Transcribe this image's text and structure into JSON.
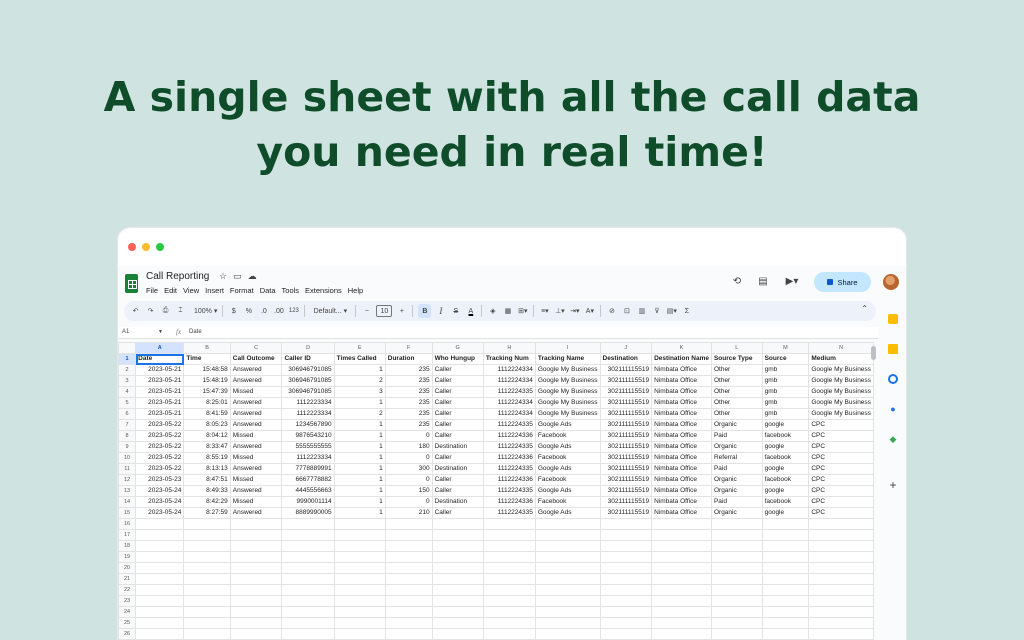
{
  "headline": {
    "line1": "A single sheet with all the call data",
    "line2": "you need in real time!"
  },
  "window": {
    "controls": [
      "close",
      "minimize",
      "maximize"
    ]
  },
  "app": {
    "title": "Call Reporting",
    "menu": [
      "File",
      "Edit",
      "View",
      "Insert",
      "Format",
      "Data",
      "Tools",
      "Extensions",
      "Help"
    ],
    "share_label": "Share",
    "toolbar": {
      "zoom": "100%",
      "currency": "$",
      "percent": "%",
      "dec_decrease": ".0",
      "dec_increase": ".00",
      "format_123": "123",
      "font": "Default...",
      "font_size": "10",
      "minus": "−",
      "plus": "+",
      "bold": "B",
      "italic": "I",
      "strike": "S",
      "text_color": "A",
      "sigma": "Σ"
    },
    "name_box": "A1",
    "formula_value": "Date"
  },
  "colors": {
    "headline": "#0f4d2a",
    "background": "#cfe3e0",
    "share_bg": "#c2e7ff",
    "selection": "#1a73e8"
  },
  "columns": [
    "A",
    "B",
    "C",
    "D",
    "E",
    "F",
    "G",
    "H",
    "I",
    "J",
    "K",
    "L",
    "M",
    "N"
  ],
  "rows": [
    [
      "Date",
      "Time",
      "Call Outcome",
      "Caller ID",
      "Times Called",
      "Duration",
      "Who Hungup",
      "Tracking Num",
      "Tracking Name",
      "Destination",
      "Destination Name",
      "Source Type",
      "Source",
      "Medium"
    ],
    [
      "2023-05-21",
      "15:48:58",
      "Answered",
      "306946791085",
      "1",
      "235",
      "Caller",
      "1112224334",
      "Google My Business",
      "302111115519",
      "Nimbata Office",
      "Other",
      "gmb",
      "Google My Business"
    ],
    [
      "2023-05-21",
      "15:48:19",
      "Answered",
      "306946791085",
      "2",
      "235",
      "Caller",
      "1112224334",
      "Google My Business",
      "302111115519",
      "Nimbata Office",
      "Other",
      "gmb",
      "Google My Business"
    ],
    [
      "2023-05-21",
      "15:47:39",
      "Missed",
      "306946791085",
      "3",
      "235",
      "Caller",
      "1112224335",
      "Google My Business",
      "302111115519",
      "Nimbata Office",
      "Other",
      "gmb",
      "Google My Business"
    ],
    [
      "2023-05-21",
      "8:25:01",
      "Answered",
      "1112223334",
      "1",
      "235",
      "Caller",
      "1112224334",
      "Google My Business",
      "302111115519",
      "Nimbata Office",
      "Other",
      "gmb",
      "Google My Business"
    ],
    [
      "2023-05-21",
      "8:41:59",
      "Answered",
      "1112223334",
      "2",
      "235",
      "Caller",
      "1112224334",
      "Google My Business",
      "302111115519",
      "Nimbata Office",
      "Other",
      "gmb",
      "Google My Business"
    ],
    [
      "2023-05-22",
      "8:05:23",
      "Answered",
      "1234567890",
      "1",
      "235",
      "Caller",
      "1112224335",
      "Google Ads",
      "302111115519",
      "Nimbata Office",
      "Organic",
      "google",
      "CPC"
    ],
    [
      "2023-05-22",
      "8:04:12",
      "Missed",
      "9876543210",
      "1",
      "0",
      "Caller",
      "1112224336",
      "Facebook",
      "302111115519",
      "Nimbata Office",
      "Paid",
      "facebook",
      "CPC"
    ],
    [
      "2023-05-22",
      "8:33:47",
      "Answered",
      "5555555555",
      "1",
      "180",
      "Destination",
      "1112224335",
      "Google Ads",
      "302111115519",
      "Nimbata Office",
      "Organic",
      "google",
      "CPC"
    ],
    [
      "2023-05-22",
      "8:55:19",
      "Missed",
      "1112223334",
      "1",
      "0",
      "Caller",
      "1112224336",
      "Facebook",
      "302111115519",
      "Nimbata Office",
      "Referral",
      "facebook",
      "CPC"
    ],
    [
      "2023-05-22",
      "8:13:13",
      "Answered",
      "7778889991",
      "1",
      "300",
      "Destination",
      "1112224335",
      "Google Ads",
      "302111115519",
      "Nimbata Office",
      "Paid",
      "google",
      "CPC"
    ],
    [
      "2023-05-23",
      "8:47:51",
      "Missed",
      "6667778882",
      "1",
      "0",
      "Caller",
      "1112224336",
      "Facebook",
      "302111115519",
      "Nimbata Office",
      "Organic",
      "facebook",
      "CPC"
    ],
    [
      "2023-05-24",
      "8:49:33",
      "Answered",
      "4445556663",
      "1",
      "150",
      "Caller",
      "1112224335",
      "Google Ads",
      "302111115519",
      "Nimbata Office",
      "Organic",
      "google",
      "CPC"
    ],
    [
      "2023-05-24",
      "8:42:29",
      "Missed",
      "9990001114",
      "1",
      "0",
      "Destination",
      "1112224336",
      "Facebook",
      "302111115519",
      "Nimbata Office",
      "Paid",
      "facebook",
      "CPC"
    ],
    [
      "2023-05-24",
      "8:27:59",
      "Answered",
      "8889990005",
      "1",
      "210",
      "Caller",
      "1112224335",
      "Google Ads",
      "302111115519",
      "Nimbata Office",
      "Organic",
      "google",
      "CPC"
    ]
  ],
  "empty_rows": [
    "16",
    "17",
    "18",
    "19",
    "20",
    "21",
    "22",
    "23",
    "24",
    "25",
    "26"
  ]
}
